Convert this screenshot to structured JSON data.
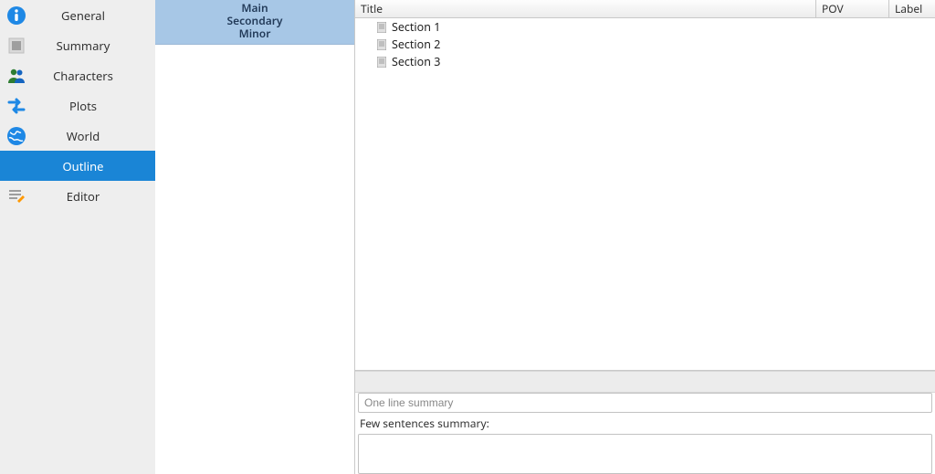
{
  "sidebar": {
    "items": [
      {
        "label": "General"
      },
      {
        "label": "Summary"
      },
      {
        "label": "Characters"
      },
      {
        "label": "Plots"
      },
      {
        "label": "World"
      },
      {
        "label": "Outline"
      },
      {
        "label": "Editor"
      }
    ],
    "selected_index": 5
  },
  "levels": {
    "lines": [
      "Main",
      "Secondary",
      "Minor"
    ]
  },
  "outline": {
    "columns": {
      "title": "Title",
      "pov": "POV",
      "label": "Label"
    },
    "rows": [
      {
        "title": "Section 1"
      },
      {
        "title": "Section 2"
      },
      {
        "title": "Section 3"
      }
    ]
  },
  "summary": {
    "oneline_placeholder": "One line summary",
    "few_label": "Few sentences summary:"
  }
}
